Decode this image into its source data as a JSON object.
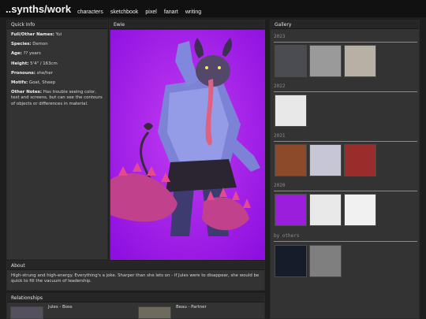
{
  "site": {
    "logo": "..synths/work",
    "nav": [
      "characters",
      "sketchbook",
      "pixel",
      "fanart",
      "writing"
    ]
  },
  "quick_info": {
    "title": "Quick Info",
    "rows": [
      {
        "key": "Full/Other Names:",
        "value": "Yui"
      },
      {
        "key": "Species:",
        "value": "Demon"
      },
      {
        "key": "Age:",
        "value": "?? years"
      },
      {
        "key": "Height:",
        "value": "5'4\" / 163cm"
      },
      {
        "key": "Pronouns:",
        "value": "she/her"
      },
      {
        "key": "Motifs:",
        "value": "Goat, Sheep"
      },
      {
        "key": "Other Notes:",
        "value": "Has trouble seeing color, text and screens, but can see the contours of objects or differences in material."
      }
    ]
  },
  "art_panel": {
    "title": "Ewie"
  },
  "about": {
    "title": "About",
    "text": "High-strung and high-energy. Everything's a joke. Sharper than she lets on - if Jules were to disappear, she would be quick to fill the vacuum of leadership."
  },
  "relationships": {
    "title": "Relationships",
    "items": [
      {
        "label": "Jules - Boss"
      },
      {
        "label": "Beau - Partner"
      }
    ]
  },
  "gallery": {
    "title": "Gallery",
    "sections": [
      {
        "label": "2023",
        "count": 3
      },
      {
        "label": "2022",
        "count": 1
      },
      {
        "label": "2021",
        "count": 3
      },
      {
        "label": "2020",
        "count": 3
      },
      {
        "label": "by others",
        "count": 2
      }
    ]
  },
  "colors": {
    "page_bg": "#1e1e1e",
    "panel_bg": "#333333",
    "art_purple": "#a020f0",
    "accent_pink": "#e05bbf"
  }
}
